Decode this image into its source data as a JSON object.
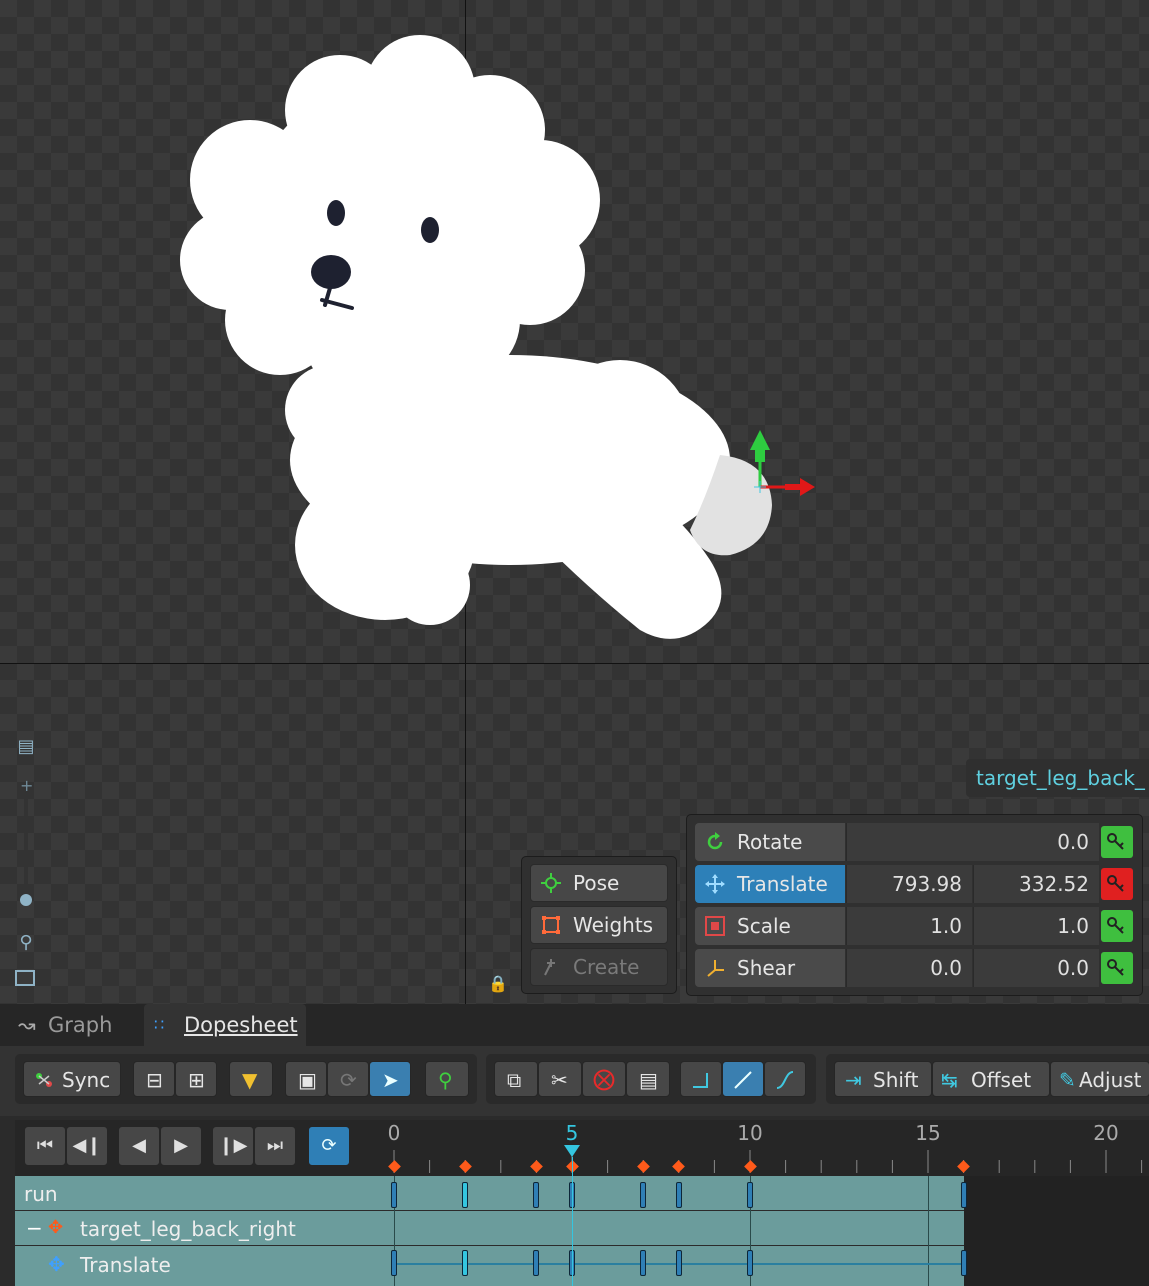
{
  "bone_tooltip": "target_leg_back_",
  "tool_buttons": [
    {
      "label": "Pose",
      "icon": "pose-icon",
      "enabled": true
    },
    {
      "label": "Weights",
      "icon": "weights-icon",
      "enabled": true
    },
    {
      "label": "Create",
      "icon": "create-icon",
      "enabled": false
    }
  ],
  "transform": {
    "rotate": {
      "label": "Rotate",
      "value": "0.0",
      "key_color": "#3fbf3f"
    },
    "translate": {
      "label": "Translate",
      "x": "793.98",
      "y": "332.52",
      "key_color": "#e02020"
    },
    "scale": {
      "label": "Scale",
      "x": "1.0",
      "y": "1.0",
      "key_color": "#3fbf3f"
    },
    "shear": {
      "label": "Shear",
      "x": "0.0",
      "y": "0.0",
      "key_color": "#3fbf3f"
    }
  },
  "tabs": [
    {
      "label": "Graph",
      "active": false
    },
    {
      "label": "Dopesheet",
      "active": true
    }
  ],
  "toolbar": {
    "sync_label": "Sync",
    "shift_label": "Shift",
    "offset_label": "Offset",
    "adjust_label": "Adjust"
  },
  "timeline": {
    "ruler_labels": [
      "0",
      "5",
      "10",
      "15",
      "20"
    ],
    "current_frame": 5,
    "keyframes": [
      0,
      2,
      4,
      5,
      7,
      8,
      10,
      16
    ],
    "rows": [
      {
        "label": "run"
      },
      {
        "label": "target_leg_back_right"
      },
      {
        "label": "Translate"
      }
    ]
  },
  "colors": {
    "accent": "#2d80b8",
    "track": "#6b9c9c",
    "key_diamond": "#ff5a1a",
    "playhead": "#34c6e0"
  }
}
